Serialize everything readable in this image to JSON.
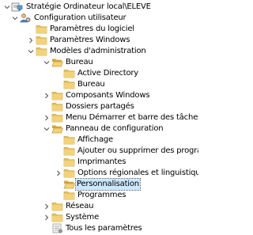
{
  "tree": {
    "items": [
      {
        "label": "Stratégie Ordinateur local\\ELEVE",
        "icon": "policy-computer-icon",
        "expander": "chevron-down",
        "level": 0
      },
      {
        "label": "Configuration utilisateur",
        "icon": "user-config-icon",
        "expander": "chevron-down",
        "level": 1
      },
      {
        "label": "Paramètres du logiciel",
        "icon": "folder-icon",
        "expander": "none",
        "level": 2
      },
      {
        "label": "Paramètres Windows",
        "icon": "folder-icon",
        "expander": "chevron-right",
        "level": 2
      },
      {
        "label": "Modèles d'administration",
        "icon": "folder-icon",
        "expander": "chevron-down",
        "level": 2
      },
      {
        "label": "Bureau",
        "icon": "folder-open-icon",
        "expander": "chevron-down",
        "level": 3
      },
      {
        "label": "Active Directory",
        "icon": "folder-icon",
        "expander": "none",
        "level": 4
      },
      {
        "label": "Bureau",
        "icon": "folder-icon",
        "expander": "none",
        "level": 4
      },
      {
        "label": "Composants Windows",
        "icon": "folder-icon",
        "expander": "chevron-right",
        "level": 3
      },
      {
        "label": "Dossiers partagés",
        "icon": "folder-icon",
        "expander": "none",
        "level": 3
      },
      {
        "label": "Menu Démarrer et barre des tâches",
        "icon": "folder-icon",
        "expander": "chevron-right",
        "level": 3
      },
      {
        "label": "Panneau de configuration",
        "icon": "folder-open-icon",
        "expander": "chevron-down",
        "level": 3
      },
      {
        "label": "Affichage",
        "icon": "folder-icon",
        "expander": "none",
        "level": 4
      },
      {
        "label": "Ajouter ou supprimer des programmes",
        "icon": "folder-icon",
        "expander": "none",
        "level": 4
      },
      {
        "label": "Imprimantes",
        "icon": "folder-icon",
        "expander": "none",
        "level": 4
      },
      {
        "label": "Options régionales et linguistiques",
        "icon": "folder-icon",
        "expander": "chevron-right",
        "level": 4
      },
      {
        "label": "Personnalisation",
        "icon": "folder-open-icon",
        "expander": "none",
        "level": 4,
        "selected": true
      },
      {
        "label": "Programmes",
        "icon": "folder-icon",
        "expander": "none",
        "level": 4
      },
      {
        "label": "Réseau",
        "icon": "folder-icon",
        "expander": "chevron-right",
        "level": 3
      },
      {
        "label": "Système",
        "icon": "folder-icon",
        "expander": "chevron-right",
        "level": 3
      },
      {
        "label": "Tous les paramètres",
        "icon": "settings-list-icon",
        "expander": "none",
        "level": 3
      }
    ]
  },
  "colors": {
    "folder": "#e8c35a",
    "folder_dark": "#d4a63a",
    "selection": "#cce8ff",
    "text": "#000000"
  }
}
